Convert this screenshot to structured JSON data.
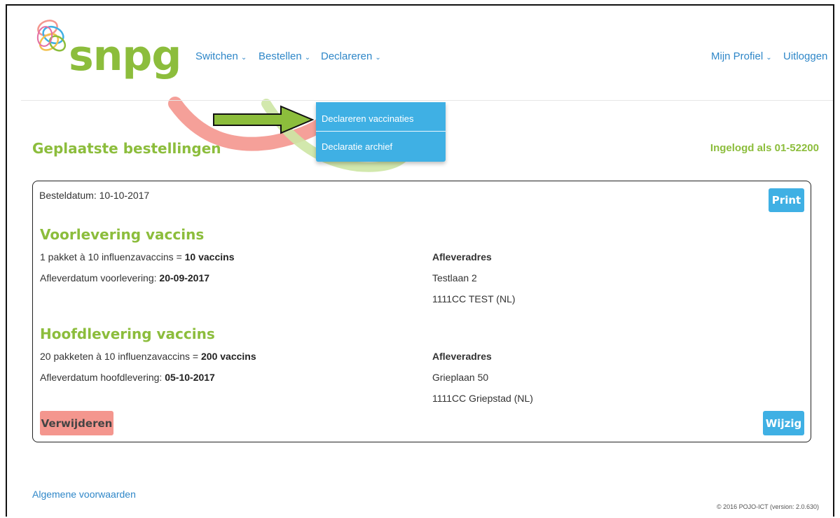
{
  "brand": {
    "name": "snpg",
    "accent_green": "#8cbd3c",
    "accent_blue": "#3fb0e4",
    "link_blue": "#2f87c8",
    "danger_pink": "#f4968e"
  },
  "nav": {
    "items": [
      {
        "label": "Switchen",
        "icon": "chevron-down-icon"
      },
      {
        "label": "Bestellen",
        "icon": "chevron-down-icon"
      },
      {
        "label": "Declareren",
        "icon": "chevron-down-icon"
      }
    ],
    "right": [
      {
        "label": "Mijn Profiel",
        "icon": "chevron-down-icon"
      },
      {
        "label": "Uitloggen"
      }
    ],
    "chevron": "⌄"
  },
  "dropdown": {
    "items": [
      {
        "label": "Declareren vaccinaties"
      },
      {
        "label": "Declaratie archief"
      }
    ]
  },
  "page": {
    "title": "Geplaatste bestellingen",
    "logged_in_as": "Ingelogd als 01-52200"
  },
  "order": {
    "date_line": "Besteldatum: 10-10-2017",
    "print_label": "Print",
    "delete_label": "Verwijderen",
    "edit_label": "Wijzig",
    "sections": [
      {
        "title": "Voorlevering vaccins",
        "qty_prefix": "1 pakket à 10 influenzavaccins = ",
        "qty_total": "10 vaccins",
        "date_prefix": "Afleverdatum voorlevering: ",
        "date_value": "20-09-2017",
        "address_label": "Afleveradres",
        "address_line1": "Testlaan 2",
        "address_line2": "1111CC TEST (NL)"
      },
      {
        "title": "Hoofdlevering vaccins",
        "qty_prefix": "20 pakketen à 10 influenzavaccins = ",
        "qty_total": "200 vaccins",
        "date_prefix": "Afleverdatum hoofdlevering: ",
        "date_value": "05-10-2017",
        "address_label": "Afleveradres",
        "address_line1": "Grieplaan 50",
        "address_line2": "1111CC Griepstad (NL)"
      }
    ]
  },
  "footer": {
    "terms_link": "Algemene voorwaarden",
    "copyright": "© 2016 POJO-ICT (version: 2.0.630)"
  }
}
